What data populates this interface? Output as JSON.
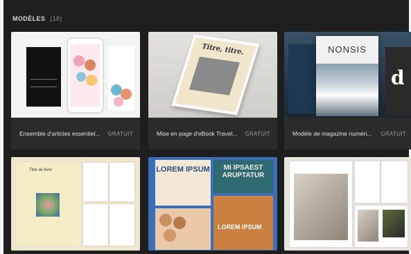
{
  "section": {
    "title": "MODÈLES",
    "count": "(18)"
  },
  "cards": [
    {
      "title": "Ensemble d'articles essentiel...",
      "price": "GRATUIT"
    },
    {
      "title": "Mise en page d'eBook Travel...",
      "price": "GRATUIT"
    },
    {
      "title": "Modèle de magazine numéri...",
      "price": "GRATUIT"
    }
  ],
  "thumbnails": {
    "card2_heading": "Titre, titre.",
    "card3_masthead": "NONSIS",
    "card3_side_letter": "d",
    "b1_label": "Titre du livre",
    "b2_lorem": "LOREM IPSUM",
    "b2_mi": "MI IPSAEST ARUPTATUR",
    "b2_lorem2": "LOREM IPSUM"
  }
}
